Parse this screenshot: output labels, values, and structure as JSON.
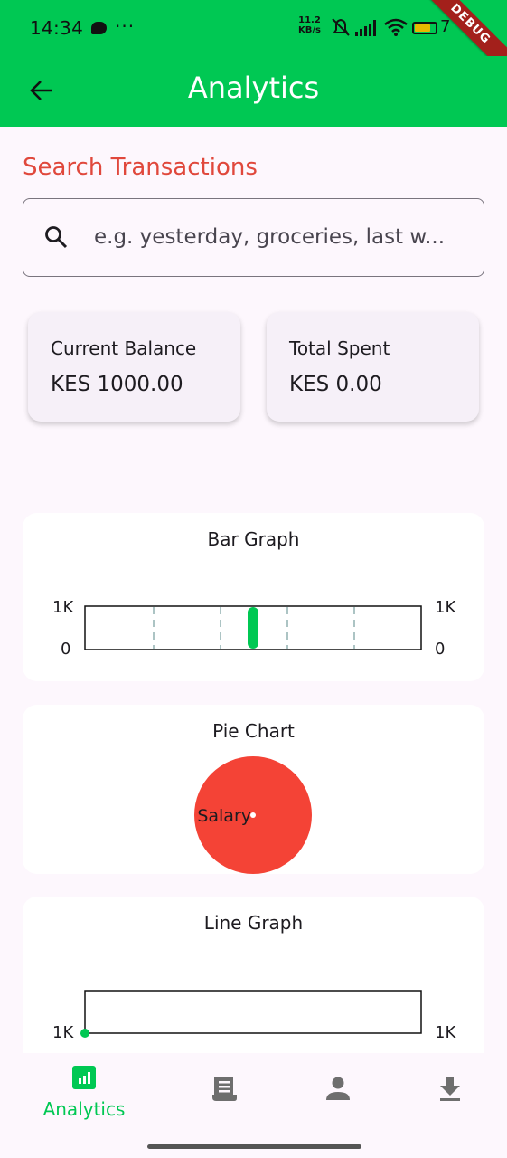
{
  "status_bar": {
    "time": "14:34",
    "dots": "···",
    "speed_value": "11.2",
    "speed_unit": "KB/s",
    "battery_text": "7",
    "debug_label": "DEBUG"
  },
  "app_bar": {
    "title": "Analytics"
  },
  "search": {
    "heading": "Search Transactions",
    "placeholder": "e.g. yesterday, groceries, last w..."
  },
  "summary": {
    "balance_label": "Current Balance",
    "balance_value": "KES 1000.00",
    "spent_label": "Total Spent",
    "spent_value": "KES 0.00"
  },
  "bar_graph": {
    "title": "Bar Graph",
    "y_top_left": "1K",
    "y_bottom_left": "0",
    "y_top_right": "1K",
    "y_bottom_right": "0"
  },
  "pie_chart": {
    "title": "Pie Chart"
  },
  "line_graph": {
    "title": "Line Graph",
    "y_label_left": "1K",
    "y_label_right": "1K"
  },
  "bottom_nav": {
    "items": [
      {
        "label": "Analytics",
        "icon": "analytics-icon",
        "active": true
      },
      {
        "label": "",
        "icon": "receipt-icon",
        "active": false
      },
      {
        "label": "",
        "icon": "person-icon",
        "active": false
      },
      {
        "label": "",
        "icon": "download-icon",
        "active": false
      }
    ]
  },
  "colors": {
    "primary": "#00c853",
    "heading_red": "#e0483c",
    "pie_red": "#f44336",
    "background": "#fdf7fd"
  },
  "chart_data": [
    {
      "type": "bar",
      "title": "Bar Graph",
      "categories": [
        ""
      ],
      "values": [
        1000
      ],
      "ylim": [
        0,
        1000
      ],
      "color": "#00c853"
    },
    {
      "type": "pie",
      "title": "Pie Chart",
      "labels": [
        "Salary"
      ],
      "values": [
        1000
      ],
      "colors": [
        "#f44336"
      ]
    },
    {
      "type": "line",
      "title": "Line Graph",
      "x": [
        0
      ],
      "y": [
        1000
      ],
      "color": "#00c853"
    }
  ]
}
